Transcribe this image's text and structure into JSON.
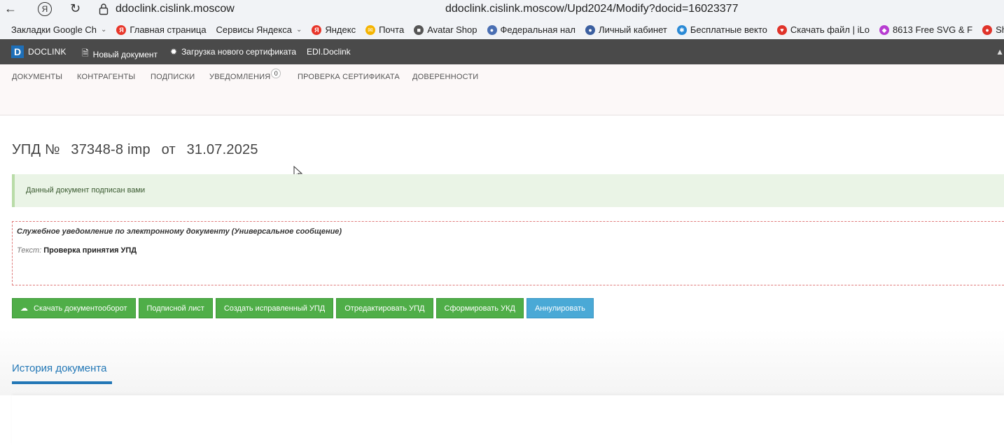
{
  "browser": {
    "host": "ddoclink.cislink.moscow",
    "url": "ddoclink.cislink.moscow/Upd2024/Modify?docid=16023377",
    "yandex_btn": "Я",
    "icons": [
      "back-icon",
      "reload-icon",
      "lock-icon"
    ]
  },
  "bookmarks": [
    {
      "label": "Закладки Google Ch",
      "chevron": true,
      "icon": "",
      "color": ""
    },
    {
      "label": "Главная страница",
      "icon": "Я",
      "color": "#e8362a"
    },
    {
      "label": "Сервисы Яндекса",
      "chevron": true,
      "icon": "",
      "color": ""
    },
    {
      "label": "Яндекс",
      "icon": "Я",
      "color": "#e8362a"
    },
    {
      "label": "Почта",
      "icon": "✉",
      "color": "#f5b400"
    },
    {
      "label": "Avatar Shop",
      "icon": "■",
      "color": "#555555"
    },
    {
      "label": "Федеральная нал",
      "icon": "●",
      "color": "#4a6fb3"
    },
    {
      "label": "Личный кабинет",
      "icon": "●",
      "color": "#3b5fa0"
    },
    {
      "label": "Бесплатные векто",
      "icon": "✱",
      "color": "#2a8ad6"
    },
    {
      "label": "Скачать файл | iLo",
      "icon": "♥",
      "color": "#e0332a"
    },
    {
      "label": "8613 Free SVG & F",
      "icon": "◆",
      "color": "#b73cd1"
    },
    {
      "label": "Shi",
      "icon": "●",
      "color": "#e0332a"
    }
  ],
  "app": {
    "logo_letter": "D",
    "logo_text": "DOCLINK",
    "new_doc": "Новый документ",
    "upload_cert": "Загрузка нового сертификата",
    "edi": "EDI.Doclink"
  },
  "subnav": {
    "documents": "ДОКУМЕНТЫ",
    "contractors": "КОНТРАГЕНТЫ",
    "subscriptions": "ПОДПИСКИ",
    "notifications": "УВЕДОМЛЕНИЯ",
    "notifications_count": "0",
    "cert_check": "ПРОВЕРКА СЕРТИФИКАТА",
    "poa": "ДОВЕРЕННОСТИ"
  },
  "document": {
    "prefix": "УПД №",
    "number": "37348-8 imp",
    "from": "от",
    "date": "31.07.2025"
  },
  "alert": {
    "text": "Данный документ подписан вами"
  },
  "notice": {
    "title": "Служебное уведомление по электронному документу (Универсальное сообщение)",
    "text_label": "Текст:",
    "text_value": "Проверка принятия УПД"
  },
  "actions": {
    "download": "Скачать документооборот",
    "sign_sheet": "Подписной лист",
    "create_corrected": "Создать исправленный УПД",
    "edit": "Отредактировать УПД",
    "form_ukd": "Сформировать УКД",
    "annul": "Аннулировать"
  },
  "history": {
    "tab": "История документа"
  },
  "colors": {
    "accent": "#2277b6",
    "button_green": "#4fae48",
    "button_blue": "#4aa9d6",
    "topbar": "#4a4a4a"
  }
}
